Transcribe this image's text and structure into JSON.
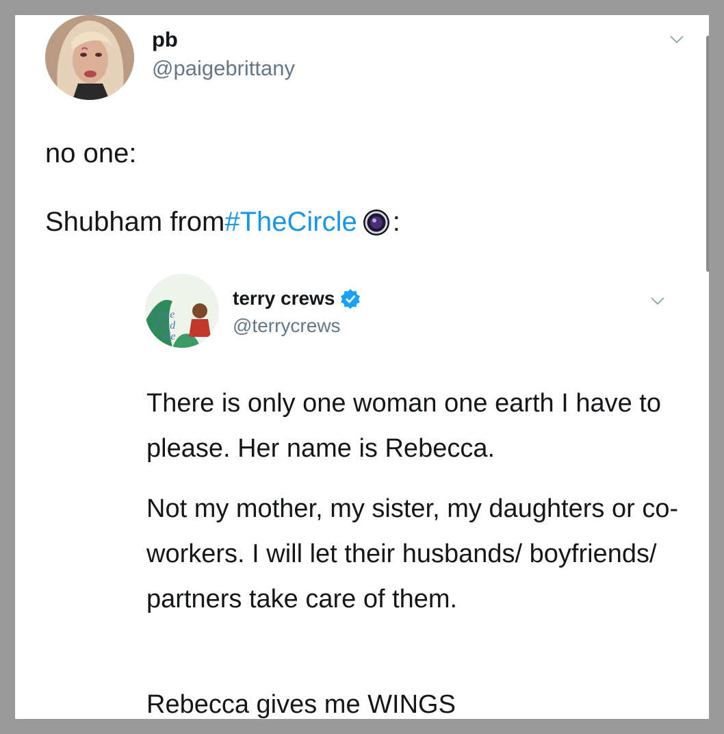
{
  "tweet": {
    "display_name": "pb",
    "handle": "@paigebrittany",
    "line1": "no one:",
    "line2_prefix": "Shubham from ",
    "hashtag": "#TheCircle",
    "line2_suffix": ":"
  },
  "quoted_tweet": {
    "display_name": "terry crews",
    "handle": "@terrycrews",
    "paragraph1": "There is only one woman one earth I have to please. Her name is Rebecca.",
    "paragraph2": "Not my mother, my sister, my daughters or co-workers. I will let their husbands/ boyfriends/ partners take care of them.",
    "paragraph3": "Rebecca gives me WINGS"
  },
  "icons": {
    "menu": "chevron-down-icon",
    "verified": "verified-badge-icon",
    "hashtag_emoji": "circle-eye-icon"
  },
  "colors": {
    "hashtag": "#1b95e0",
    "handle": "#657786",
    "verified": "#1da1f2"
  }
}
